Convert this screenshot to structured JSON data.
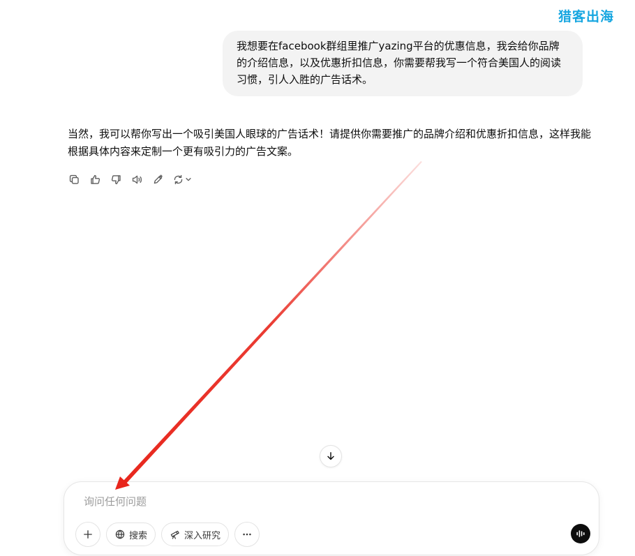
{
  "watermark": "猎客出海",
  "conversation": {
    "user_message": "我想要在facebook群组里推广yazing平台的优惠信息，我会给你品牌的介绍信息，以及优惠折扣信息，你需要帮我写一个符合美国人的阅读习惯，引人入胜的广告话术。",
    "assistant_message": "当然，我可以帮你写出一个吸引美国人眼球的广告话术！请提供你需要推广的品牌介绍和优惠折扣信息，这样我能根据具体内容来定制一个更有吸引力的广告文案。"
  },
  "message_actions": [
    "copy-icon",
    "thumbs-up-icon",
    "thumbs-down-icon",
    "read-aloud-icon",
    "edit-icon",
    "regenerate-icon"
  ],
  "composer": {
    "placeholder": "询问任何问题",
    "search_label": "搜索",
    "deep_research_label": "深入研究"
  },
  "colors": {
    "watermark": "#16a6e0",
    "annotation_arrow": "#e8261c",
    "user_bubble_bg": "#f3f3f3"
  }
}
